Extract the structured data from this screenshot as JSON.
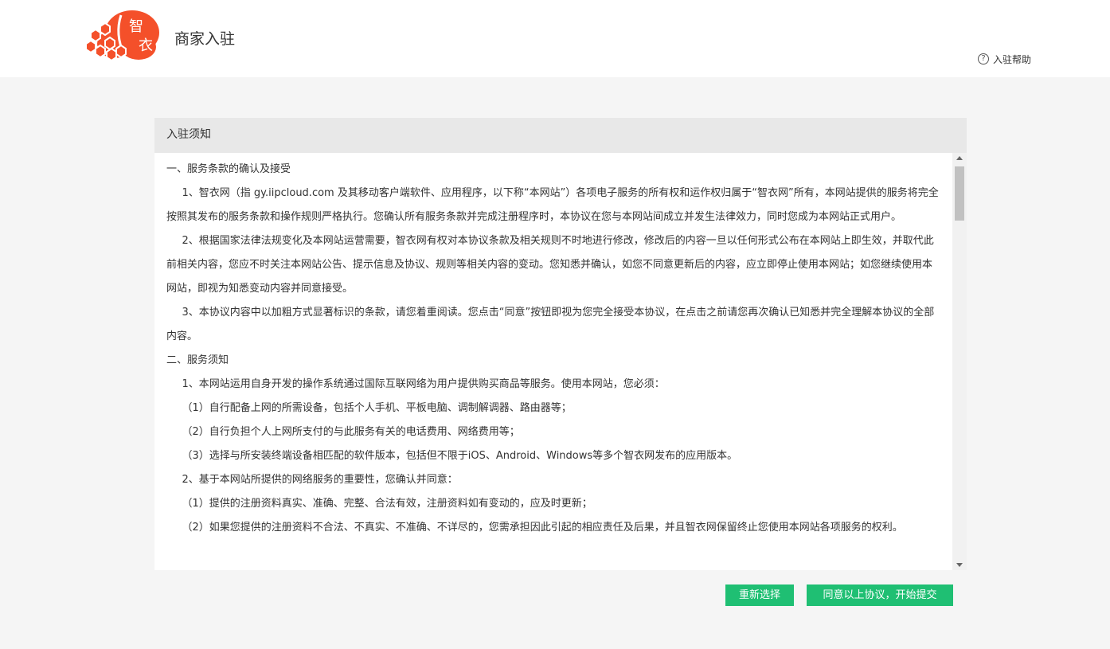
{
  "header": {
    "logo_text_1": "智",
    "logo_text_2": "衣",
    "title": "商家入驻",
    "help_icon": "?",
    "help_label": "入驻帮助"
  },
  "panel": {
    "title": "入驻须知",
    "paragraphs": [
      "一、服务条款的确认及接受",
      "1、智衣网（指 gy.iipcloud.com 及其移动客户端软件、应用程序，以下称“本网站”）各项电子服务的所有权和运作权归属于“智衣网”所有，本网站提供的服务将完全按照其发布的服务条款和操作规则严格执行。您确认所有服务条款并完成注册程序时，本协议在您与本网站间成立并发生法律效力，同时您成为本网站正式用户。",
      "2、根据国家法律法规变化及本网站运营需要，智衣网有权对本协议条款及相关规则不时地进行修改，修改后的内容一旦以任何形式公布在本网站上即生效，并取代此前相关内容，您应不时关注本网站公告、提示信息及协议、规则等相关内容的变动。您知悉并确认，如您不同意更新后的内容，应立即停止使用本网站；如您继续使用本网站，即视为知悉变动内容并同意接受。",
      "3、本协议内容中以加粗方式显著标识的条款，请您着重阅读。您点击“同意”按钮即视为您完全接受本协议，在点击之前请您再次确认已知悉并完全理解本协议的全部内容。",
      "二、服务须知",
      "1、本网站运用自身开发的操作系统通过国际互联网络为用户提供购买商品等服务。使用本网站，您必须：",
      "（1）自行配备上网的所需设备，包括个人手机、平板电脑、调制解调器、路由器等；",
      "（2）自行负担个人上网所支付的与此服务有关的电话费用、网络费用等；",
      "（3）选择与所安装终端设备相匹配的软件版本，包括但不限于iOS、Android、Windows等多个智衣网发布的应用版本。",
      "2、基于本网站所提供的网络服务的重要性，您确认并同意：",
      "（1）提供的注册资料真实、准确、完整、合法有效，注册资料如有变动的，应及时更新；",
      "（2）如果您提供的注册资料不合法、不真实、不准确、不详尽的，您需承担因此引起的相应责任及后果，并且智衣网保留终止您使用本网站各项服务的权利。"
    ]
  },
  "buttons": {
    "reselect": "重新选择",
    "agree": "同意以上协议，开始提交"
  },
  "colors": {
    "accent": "#1fbf73",
    "logo": "#f4502a"
  }
}
